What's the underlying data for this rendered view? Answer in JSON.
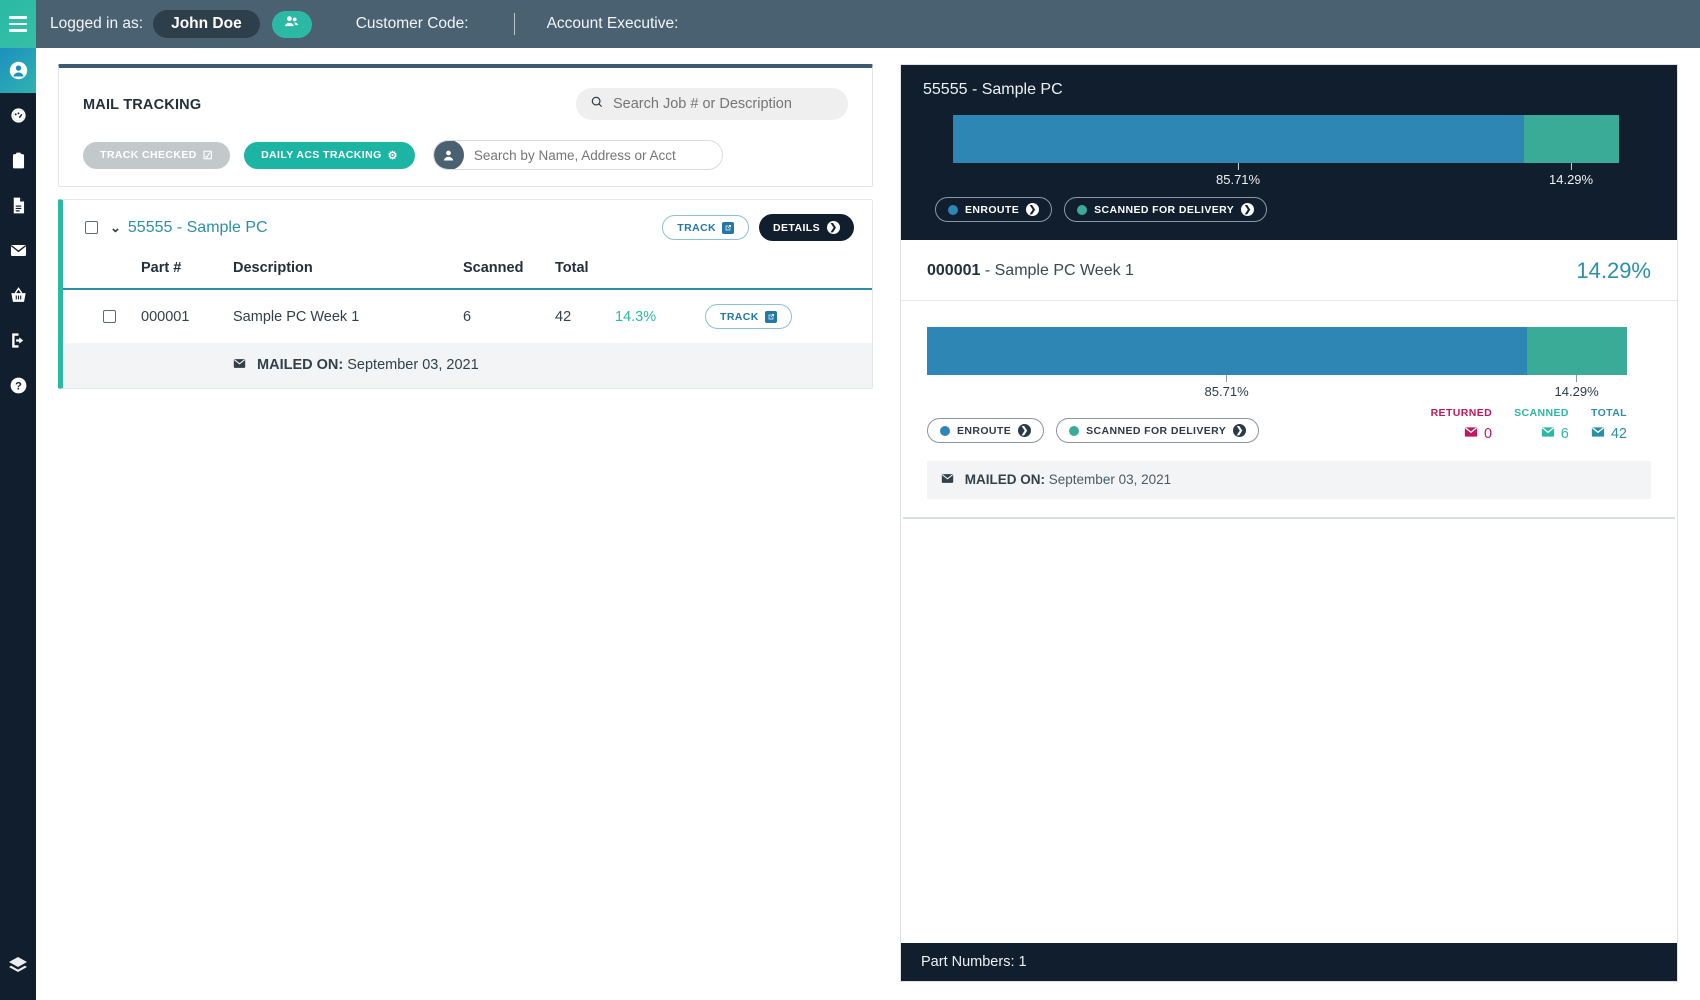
{
  "topbar": {
    "logged_in_label": "Logged in as:",
    "user_name": "John Doe",
    "people_icon": "people-icon",
    "customer_code_label": "Customer Code:",
    "customer_code_value": "",
    "account_exec_label": "Account Executive:",
    "account_exec_value": ""
  },
  "sidebar": {
    "menu_icon": "hamburger-icon",
    "items": [
      {
        "name": "profile",
        "icon": "user-circle-icon",
        "active": true
      },
      {
        "name": "dashboard",
        "icon": "gauge-icon",
        "active": false
      },
      {
        "name": "jobs",
        "icon": "clipboard-icon",
        "active": false
      },
      {
        "name": "reports",
        "icon": "document-icon",
        "active": false
      },
      {
        "name": "mail",
        "icon": "envelope-icon",
        "active": false
      },
      {
        "name": "orders",
        "icon": "basket-icon",
        "active": false
      },
      {
        "name": "logout",
        "icon": "exit-icon",
        "active": false
      },
      {
        "name": "help",
        "icon": "question-circle-icon",
        "active": false
      }
    ],
    "footer_icon": "layers-icon"
  },
  "left_panel": {
    "title": "MAIL TRACKING",
    "search_job": {
      "placeholder": "Search Job # or Description",
      "value": "",
      "icon": "search-icon"
    },
    "track_checked_label": "TRACK CHECKED",
    "daily_acs_label": "DAILY ACS TRACKING",
    "search_name": {
      "placeholder": "Search by Name, Address or Acct",
      "value": "",
      "icon": "user-icon"
    },
    "job": {
      "title": "55555 - Sample PC",
      "track_label": "TRACK",
      "details_label": "DETAILS",
      "columns": [
        "Part #",
        "Description",
        "Scanned",
        "Total"
      ],
      "rows": [
        {
          "part": "000001",
          "description": "Sample PC Week 1",
          "scanned": "6",
          "total": "42",
          "percent": "14.3%",
          "track_label": "TRACK"
        }
      ],
      "mailed_on_label": "MAILED ON:",
      "mailed_on_value": "September 03, 2021"
    }
  },
  "right_panel": {
    "header_title": "55555 - Sample PC",
    "legend": {
      "enroute": "ENROUTE",
      "scanned_for_delivery": "SCANNED FOR DELIVERY"
    },
    "part": {
      "number": "000001",
      "separator": "-",
      "name": "Sample PC Week 1",
      "percent": "14.29%"
    },
    "stats": {
      "returned_label": "RETURNED",
      "returned_value": "0",
      "scanned_label": "SCANNED",
      "scanned_value": "6",
      "total_label": "TOTAL",
      "total_value": "42"
    },
    "mailed_on_label": "MAILED ON:",
    "mailed_on_value": "September 03, 2021",
    "footer": "Part Numbers: 1"
  },
  "chart_data": [
    {
      "type": "bar",
      "title": "55555 - Sample PC",
      "orientation": "horizontal-stacked",
      "categories": [
        "Enroute",
        "Scanned for Delivery"
      ],
      "values": [
        85.71,
        14.29
      ],
      "tick_labels": [
        "85.71%",
        "14.29%"
      ],
      "colors": [
        "#2e86b4",
        "#3aab96"
      ],
      "xlim": [
        0,
        100
      ],
      "grid": false,
      "legend": [
        "ENROUTE",
        "SCANNED FOR DELIVERY"
      ],
      "legend_position": "bottom-left"
    },
    {
      "type": "bar",
      "title": "000001 - Sample PC Week 1",
      "orientation": "horizontal-stacked",
      "categories": [
        "Enroute",
        "Scanned for Delivery"
      ],
      "values": [
        85.71,
        14.29
      ],
      "tick_labels": [
        "85.71%",
        "14.29%"
      ],
      "colors": [
        "#2e86b4",
        "#3aab96"
      ],
      "xlim": [
        0,
        100
      ],
      "grid": false,
      "legend": [
        "ENROUTE",
        "SCANNED FOR DELIVERY"
      ],
      "legend_position": "bottom-left",
      "annotations": {
        "percent": "14.29%",
        "returned": 0,
        "scanned": 6,
        "total": 42
      }
    }
  ],
  "colors": {
    "teal": "#2bb9a5",
    "dark": "#101e2e",
    "topbar": "#4a6172",
    "bar_blue": "#2e86b4",
    "bar_green": "#3aab96",
    "link_blue": "#2b8fa8",
    "crimson": "#c2185b"
  }
}
